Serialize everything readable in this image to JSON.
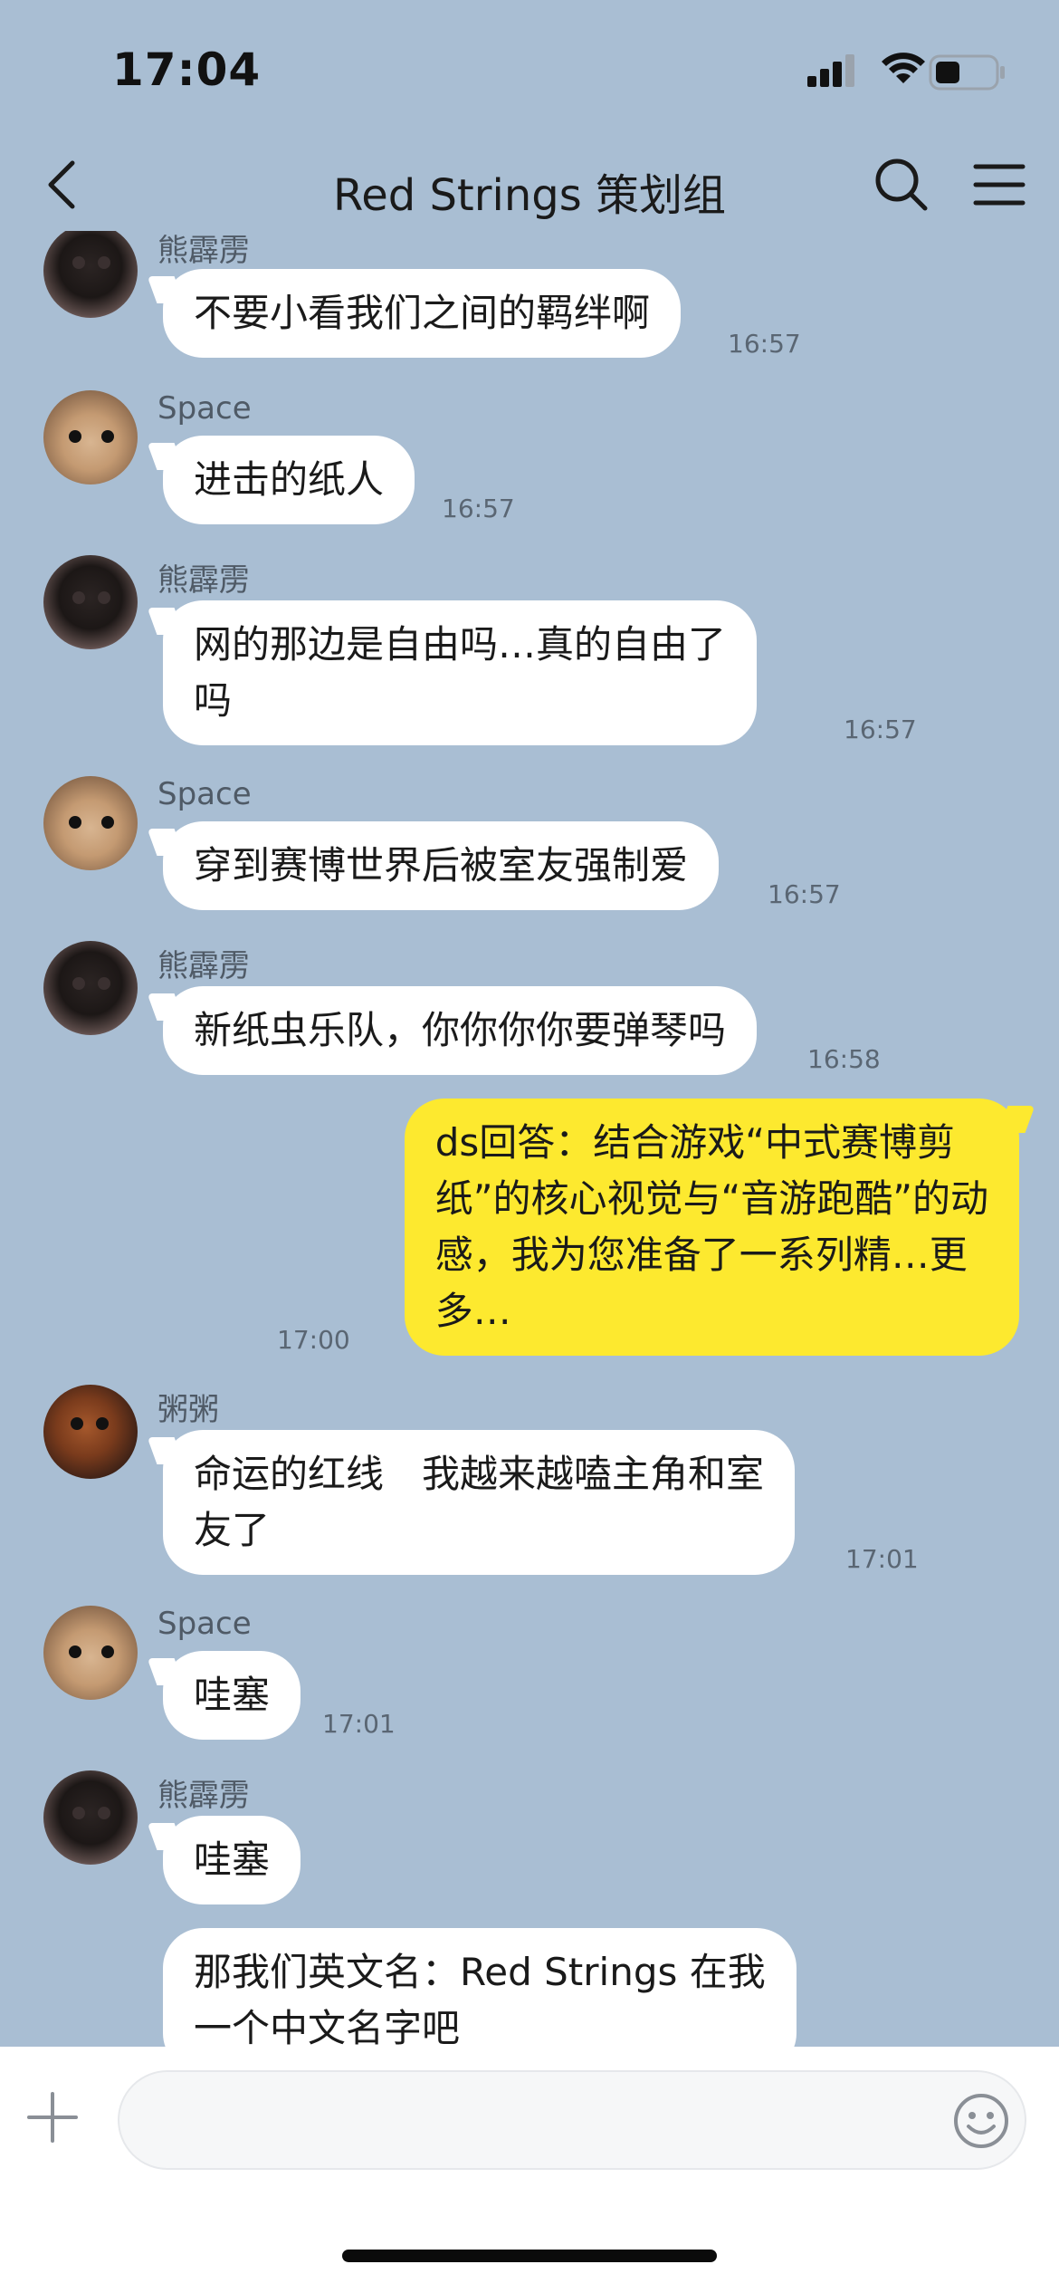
{
  "status_bar": {
    "time": "17:04"
  },
  "header": {
    "title": "Red Strings 策划组"
  },
  "messages": [
    {
      "sender": "熊霹雳",
      "text": "不要小看我们之间的羁绊啊",
      "time": "16:57"
    },
    {
      "sender": "Space",
      "text": "进击的纸人",
      "time": "16:57"
    },
    {
      "sender": "熊霹雳",
      "text_lines": [
        "网的那边是自由吗…真的自由了",
        "吗"
      ],
      "time": "16:57"
    },
    {
      "sender": "Space",
      "text": "穿到赛博世界后被室友强制爱",
      "time": "16:57"
    },
    {
      "sender": "熊霹雳",
      "text": "新纸虫乐队，你你你你要弹琴吗",
      "time": "16:58"
    },
    {
      "sender": "me",
      "text_lines": [
        "ds回答：结合游戏“中式赛博剪",
        "纸”的核心视觉与“音游跑酷”的动",
        "感，我为您准备了一系列精…更",
        "多…"
      ],
      "time": "17:00"
    },
    {
      "sender": "粥粥",
      "text_lines": [
        "命运的红线　我越来越嗑主角和室",
        "友了"
      ],
      "time": "17:01"
    },
    {
      "sender": "Space",
      "text": "哇塞",
      "time": "17:01"
    },
    {
      "sender": "熊霹雳",
      "text": "哇塞",
      "time": ""
    },
    {
      "sender": "熊霹雳",
      "text_lines": [
        "那我们英文名：Red Strings 在我",
        "一个中文名字吧"
      ],
      "time": ""
    }
  ],
  "input": {
    "placeholder": "",
    "value": ""
  },
  "icons": {
    "back": "chevron-left-icon",
    "search": "search-icon",
    "menu": "menu-icon",
    "plus": "plus-icon",
    "emoji": "emoji-icon"
  },
  "colors": {
    "background": "#a9bed3",
    "incoming_bubble": "#ffffff",
    "outgoing_bubble": "#fde92f"
  }
}
